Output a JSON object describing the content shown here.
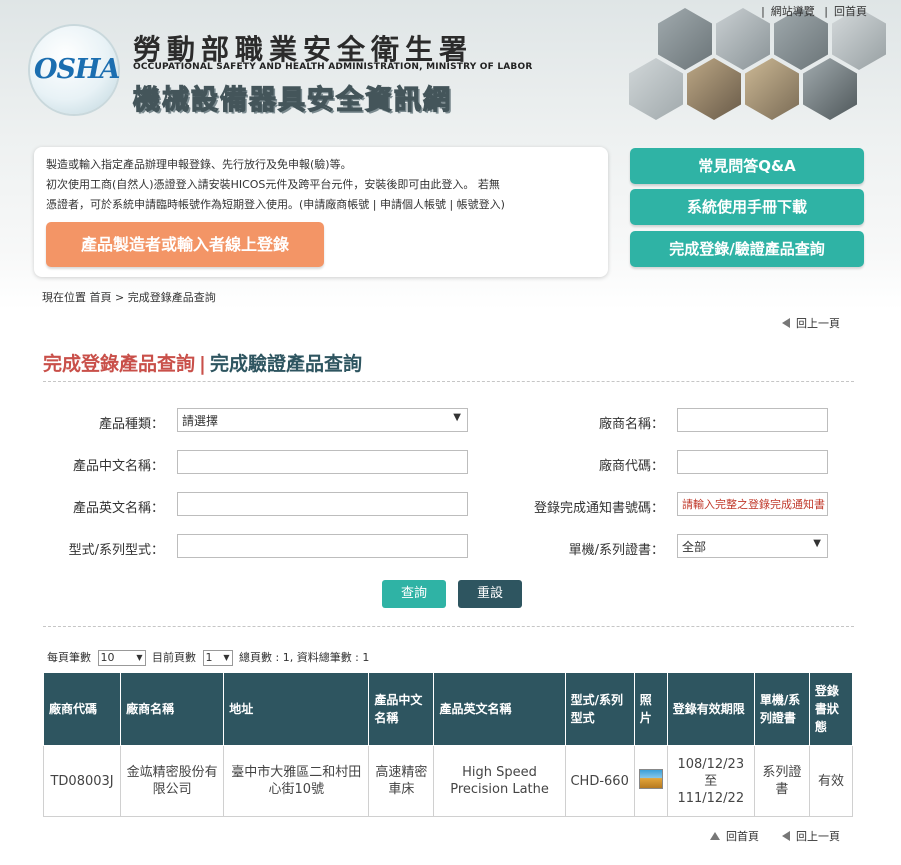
{
  "toplinks": [
    "網站導覽",
    "回首頁"
  ],
  "header": {
    "logo_text": "OSHA",
    "title_cn": "勞動部職業安全衛生署",
    "title_en": "OCCUPATIONAL SAFETY AND HEALTH ADMINISTRATION, MINISTRY OF LABOR",
    "title_sub": "機械設備器具安全資訊網"
  },
  "info": {
    "line1": "製造或輸入指定產品辦理申報登錄、先行放行及免申報(驗)等。",
    "line2": "初次使用工商(自然人)憑證登入請安裝HICOS元件及跨平台元件，安裝後即可由此登入。 若無",
    "line3": "憑證者，可於系統申請臨時帳號作為短期登入使用。(申請廠商帳號 | 申請個人帳號 | 帳號登入)",
    "login_button": "產品製造者或輸入者線上登錄"
  },
  "side_buttons": [
    "常見問答Q&A",
    "系統使用手冊下載",
    "完成登錄/驗證產品查詢"
  ],
  "breadcrumb": "現在位置  首頁 > 完成登錄產品查詢",
  "back_label": "回上一頁",
  "home_label": "回首頁",
  "page_title": {
    "part1": "完成登錄產品查詢",
    "sep": "|",
    "part2": "完成驗證產品查詢"
  },
  "form": {
    "product_type_label": "產品種類：",
    "product_type_value": "請選擇",
    "vendor_name_label": "廠商名稱：",
    "cn_name_label": "產品中文名稱：",
    "vendor_code_label": "廠商代碼：",
    "en_name_label": "產品英文名稱：",
    "notice_no_label": "登錄完成通知書號碼：",
    "notice_no_placeholder": "請輸入完整之登錄完成通知書",
    "model_label": "型式/系列型式：",
    "cert_label": "單機/系列證書：",
    "cert_value": "全部",
    "query_button": "查詢",
    "reset_button": "重設"
  },
  "pager": {
    "per_page_label": "每頁筆數",
    "per_page_value": "10",
    "current_label": "目前頁數",
    "current_value": "1",
    "summary": "總頁數 : 1, 資料總筆數 : 1"
  },
  "table": {
    "headers": [
      "廠商代碼",
      "廠商名稱",
      "地址",
      "產品中文名稱",
      "產品英文名稱",
      "型式/系列型式",
      "照片",
      "登錄有效期限",
      "單機/系列證書",
      "登錄書狀態"
    ],
    "rows": [
      {
        "code": "TD08003J",
        "name": "金竑精密股份有限公司",
        "address": "臺中市大雅區二和村田心街10號",
        "cn_name": "高速精密車床",
        "en_name": "High Speed Precision Lathe",
        "model": "CHD-660",
        "validity": "108/12/23 至 111/12/22",
        "cert": "系列證書",
        "status": "有效"
      }
    ]
  }
}
